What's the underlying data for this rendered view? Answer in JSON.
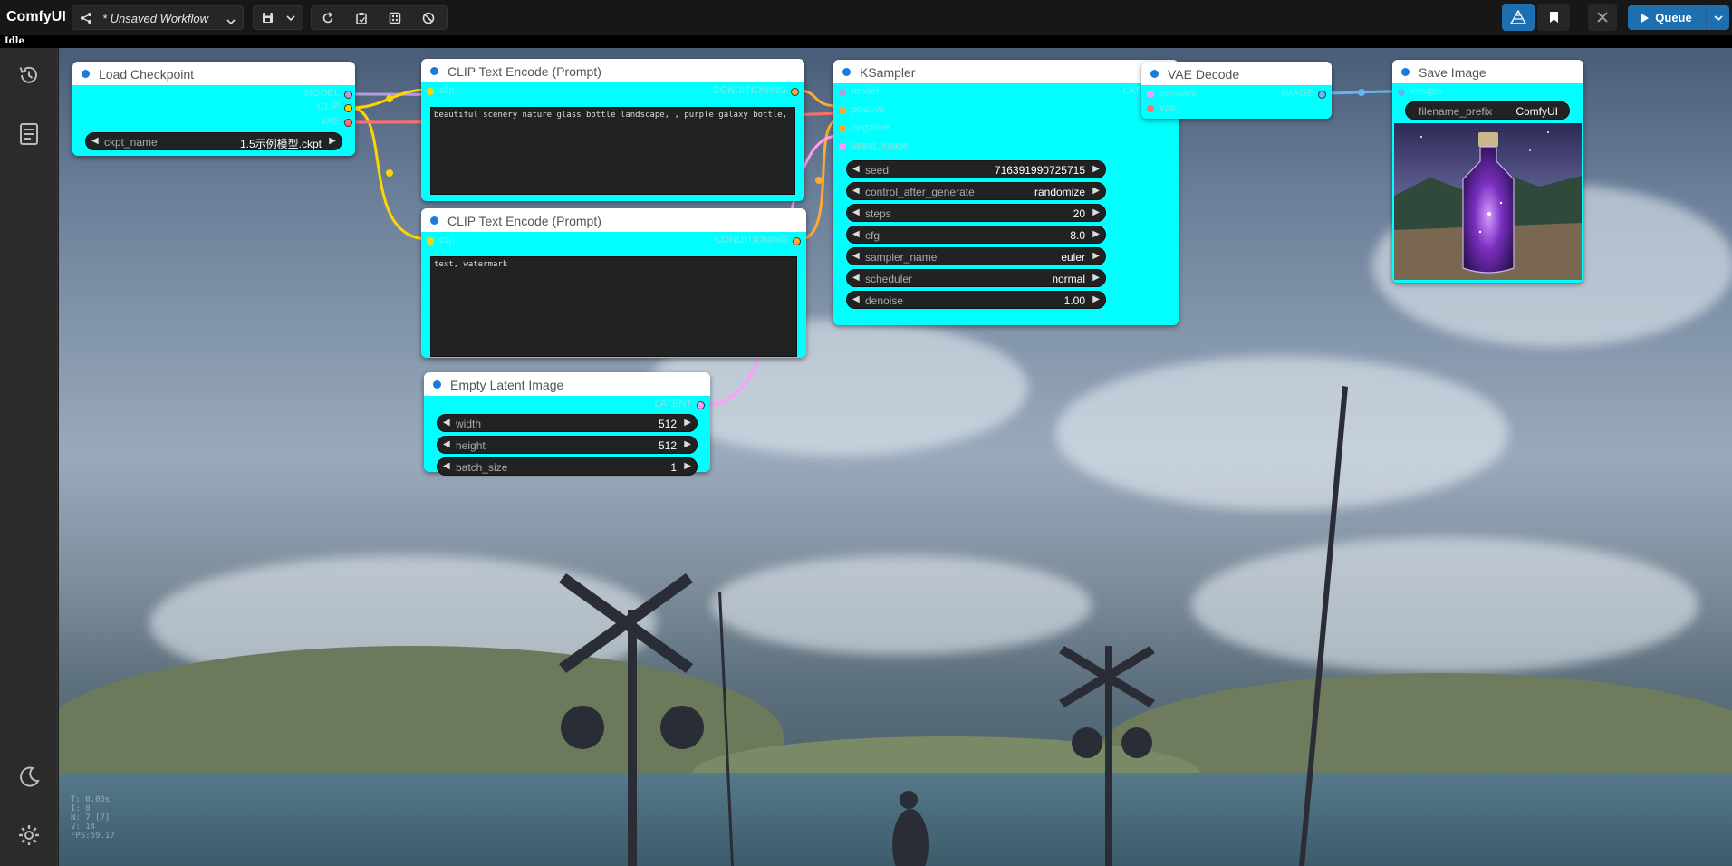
{
  "app": {
    "title": "ComfyUI",
    "status": "Idle"
  },
  "workflow_tab": {
    "name": "* Unsaved Workflow"
  },
  "queue": {
    "label": "Queue"
  },
  "sidebar": {
    "icons": [
      "history-icon",
      "library-icon",
      "theme-icon",
      "settings-icon"
    ]
  },
  "nodes": {
    "load_checkpoint": {
      "title": "Load Checkpoint",
      "outputs": [
        "MODEL",
        "CLIP",
        "VAE"
      ],
      "ckpt_name": {
        "name": "ckpt_name",
        "value": "1.5示例模型.ckpt"
      }
    },
    "clip_pos": {
      "title": "CLIP Text Encode (Prompt)",
      "input": "clip",
      "output": "CONDITIONING",
      "text": "beautiful scenery nature glass bottle landscape, , purple galaxy bottle,"
    },
    "clip_neg": {
      "title": "CLIP Text Encode (Prompt)",
      "input": "clip",
      "output": "CONDITIONING",
      "text": "text, watermark"
    },
    "empty_latent": {
      "title": "Empty Latent Image",
      "output": "LATENT",
      "widgets": [
        {
          "name": "width",
          "value": "512"
        },
        {
          "name": "height",
          "value": "512"
        },
        {
          "name": "batch_size",
          "value": "1"
        }
      ]
    },
    "ksampler": {
      "title": "KSampler",
      "inputs": [
        "model",
        "positive",
        "negative",
        "latent_image"
      ],
      "output": "LATENT",
      "widgets": [
        {
          "name": "seed",
          "value": "716391990725715"
        },
        {
          "name": "control_after_generate",
          "value": "randomize"
        },
        {
          "name": "steps",
          "value": "20"
        },
        {
          "name": "cfg",
          "value": "8.0"
        },
        {
          "name": "sampler_name",
          "value": "euler"
        },
        {
          "name": "scheduler",
          "value": "normal"
        },
        {
          "name": "denoise",
          "value": "1.00"
        }
      ]
    },
    "vae_decode": {
      "title": "VAE Decode",
      "inputs": [
        "samples",
        "vae"
      ],
      "output": "IMAGE"
    },
    "save_image": {
      "title": "Save Image",
      "input": "images",
      "filename_prefix": {
        "name": "filename_prefix",
        "value": "ComfyUI"
      }
    }
  },
  "colors": {
    "node_bg": "#00ffff",
    "node_header": "#ffffff",
    "accent": "#1e6fb0",
    "wire_model": "#b39ddb",
    "wire_clip": "#ffd500",
    "wire_vae": "#ff6e6e",
    "wire_conditioning": "#ffa931",
    "wire_latent": "#ff9cf9",
    "wire_image": "#64b5f6"
  }
}
